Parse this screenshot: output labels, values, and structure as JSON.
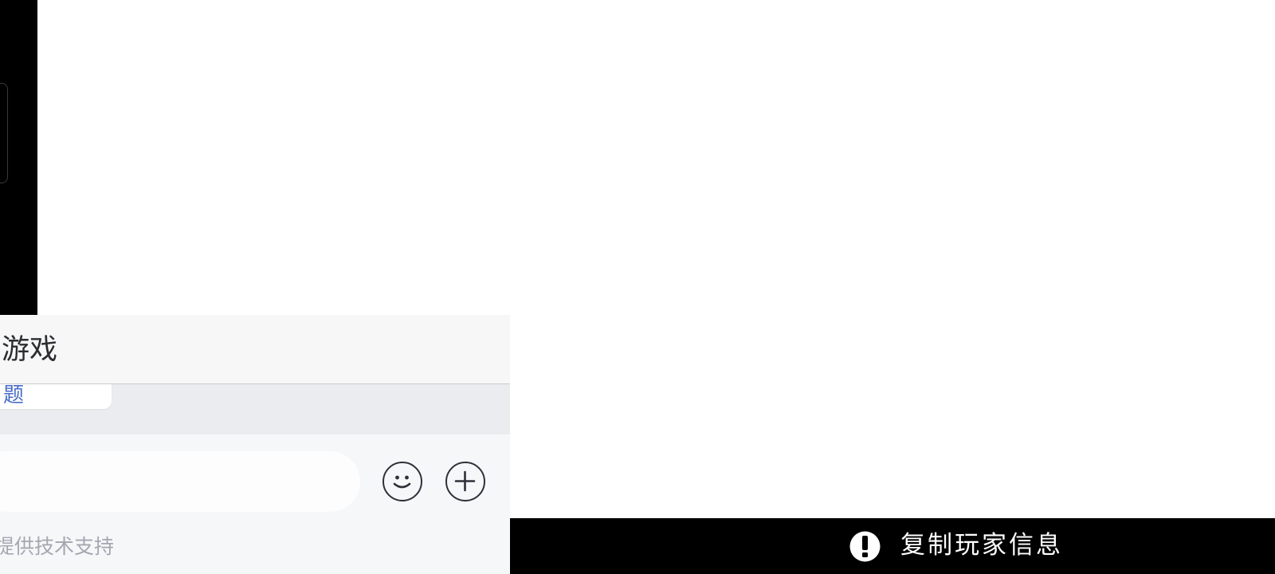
{
  "chat": {
    "title": "游戏",
    "last_message_link": "题",
    "input_placeholder": "",
    "support_text": "提供技术支持"
  },
  "toast": {
    "text": "复制玩家信息",
    "icon": "exclamation-circle-icon"
  },
  "icons": {
    "emoji": "smiley-face-icon",
    "add": "plus-circle-icon"
  },
  "colors": {
    "header_bg": "#f7f7f7",
    "messages_bg": "#eaecef",
    "link": "#4a6cc8",
    "muted_text": "#a3a8b0",
    "toast_bg": "#000000",
    "toast_text": "#ffffff"
  }
}
